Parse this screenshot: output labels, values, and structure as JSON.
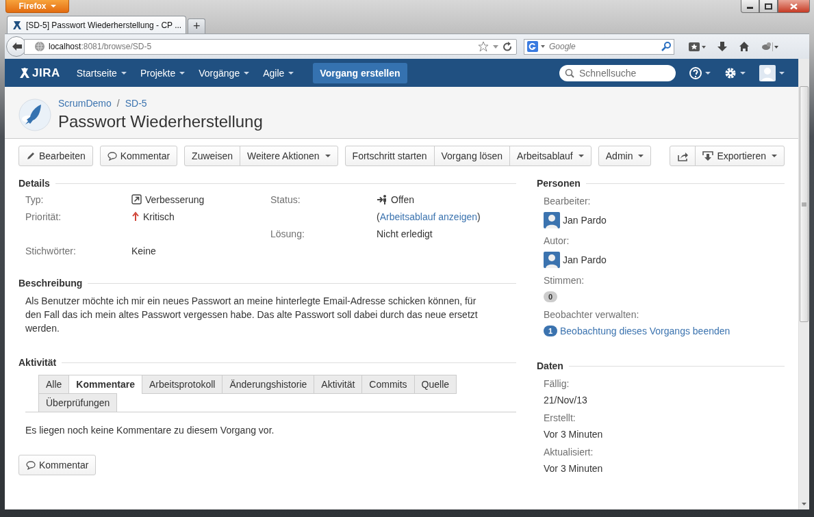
{
  "browser": {
    "menu_button": "Firefox",
    "tabs": [
      {
        "label": "[SD-5] Passwort Wiederherstellung - CP ...",
        "selected": true
      }
    ],
    "new_tab": "+",
    "url": {
      "host": "localhost",
      "rest": ":8081/browse/SD-5"
    },
    "search": {
      "placeholder": "Google"
    }
  },
  "header": {
    "logo": "JIRA",
    "menu": [
      {
        "label": "Startseite",
        "dropdown": true
      },
      {
        "label": "Projekte",
        "dropdown": true
      },
      {
        "label": "Vorgänge",
        "dropdown": true
      },
      {
        "label": "Agile",
        "dropdown": true
      }
    ],
    "create": "Vorgang erstellen",
    "search": {
      "placeholder": "Schnellsuche"
    }
  },
  "issue": {
    "breadcrumbs": [
      "ScrumDemo",
      "SD-5"
    ],
    "separator": "/",
    "title": "Passwort Wiederherstellung"
  },
  "toolbar": {
    "left": [
      [
        {
          "label": "Bearbeiten",
          "kind": "edit",
          "dropdown": false
        }
      ],
      [
        {
          "label": "Kommentar",
          "kind": "comment",
          "dropdown": false
        }
      ],
      [
        {
          "label": "Zuweisen",
          "kind": "plain",
          "dropdown": false
        },
        {
          "label": "Weitere Aktionen",
          "kind": "plain",
          "dropdown": true
        }
      ],
      [
        {
          "label": "Fortschritt starten",
          "kind": "plain",
          "dropdown": false
        },
        {
          "label": "Vorgang lösen",
          "kind": "plain",
          "dropdown": false
        },
        {
          "label": "Arbeitsablauf",
          "kind": "plain",
          "dropdown": true
        }
      ],
      [
        {
          "label": "Admin",
          "kind": "plain",
          "dropdown": true
        }
      ]
    ],
    "right": [
      [
        {
          "kind": "share",
          "dropdown": false
        },
        {
          "label": "Exportieren",
          "kind": "export",
          "dropdown": true
        }
      ]
    ]
  },
  "details": {
    "title": "Details",
    "rows": [
      {
        "left": {
          "label": "Typ:",
          "value": "Verbesserung",
          "kind": "type"
        },
        "right": {
          "label": "Status:",
          "value": "Offen",
          "kind": "status"
        }
      },
      {
        "left": {
          "label": "Priorität:",
          "value": "Kritisch",
          "kind": "priority"
        },
        "right": {
          "kind": "link",
          "before": "(",
          "link": "Arbeitsablauf anzeigen",
          "after": ")"
        }
      },
      {
        "right": {
          "label": "Lösung:",
          "value": "Nicht erledigt",
          "kind": "plain"
        }
      },
      {
        "left": {
          "label": "Stichwörter:",
          "value": "Keine",
          "kind": "plain"
        }
      }
    ]
  },
  "description": {
    "title": "Beschreibung",
    "text": "Als Benutzer möchte ich mir ein neues Passwort an meine hinterlegte Email-Adresse schicken können, für den Fall das ich mein altes Passwort vergessen habe. Das alte Passwort soll dabei durch das neue ersetzt werden."
  },
  "activity": {
    "title": "Aktivität",
    "tabs": [
      {
        "label": "Alle",
        "selected": false
      },
      {
        "label": "Kommentare",
        "selected": true
      },
      {
        "label": "Arbeitsprotokoll",
        "selected": false
      },
      {
        "label": "Änderungshistorie",
        "selected": false
      },
      {
        "label": "Aktivität",
        "selected": false
      },
      {
        "label": "Commits",
        "selected": false
      },
      {
        "label": "Quelle",
        "selected": false
      },
      {
        "label": "Überprüfungen",
        "selected": false
      }
    ],
    "empty_text": "Es liegen noch keine Kommentare zu diesem Vorgang vor.",
    "comment_button": "Kommentar"
  },
  "people": {
    "title": "Personen",
    "items": [
      {
        "kind": "user",
        "label": "Bearbeiter:",
        "value": "Jan Pardo"
      },
      {
        "kind": "user",
        "label": "Autor:",
        "value": "Jan Pardo"
      },
      {
        "kind": "count",
        "label": "Stimmen:",
        "count": "0"
      },
      {
        "kind": "watch",
        "label": "Beobachter verwalten:",
        "count": "1",
        "link": "Beobachtung dieses Vorgangs beenden"
      }
    ]
  },
  "dates": {
    "title": "Daten",
    "items": [
      {
        "label": "Fällig:",
        "value": "21/Nov/13"
      },
      {
        "label": "Erstellt:",
        "value": "Vor 3 Minuten"
      },
      {
        "label": "Aktualisiert:",
        "value": "Vor 3 Minuten"
      }
    ]
  }
}
